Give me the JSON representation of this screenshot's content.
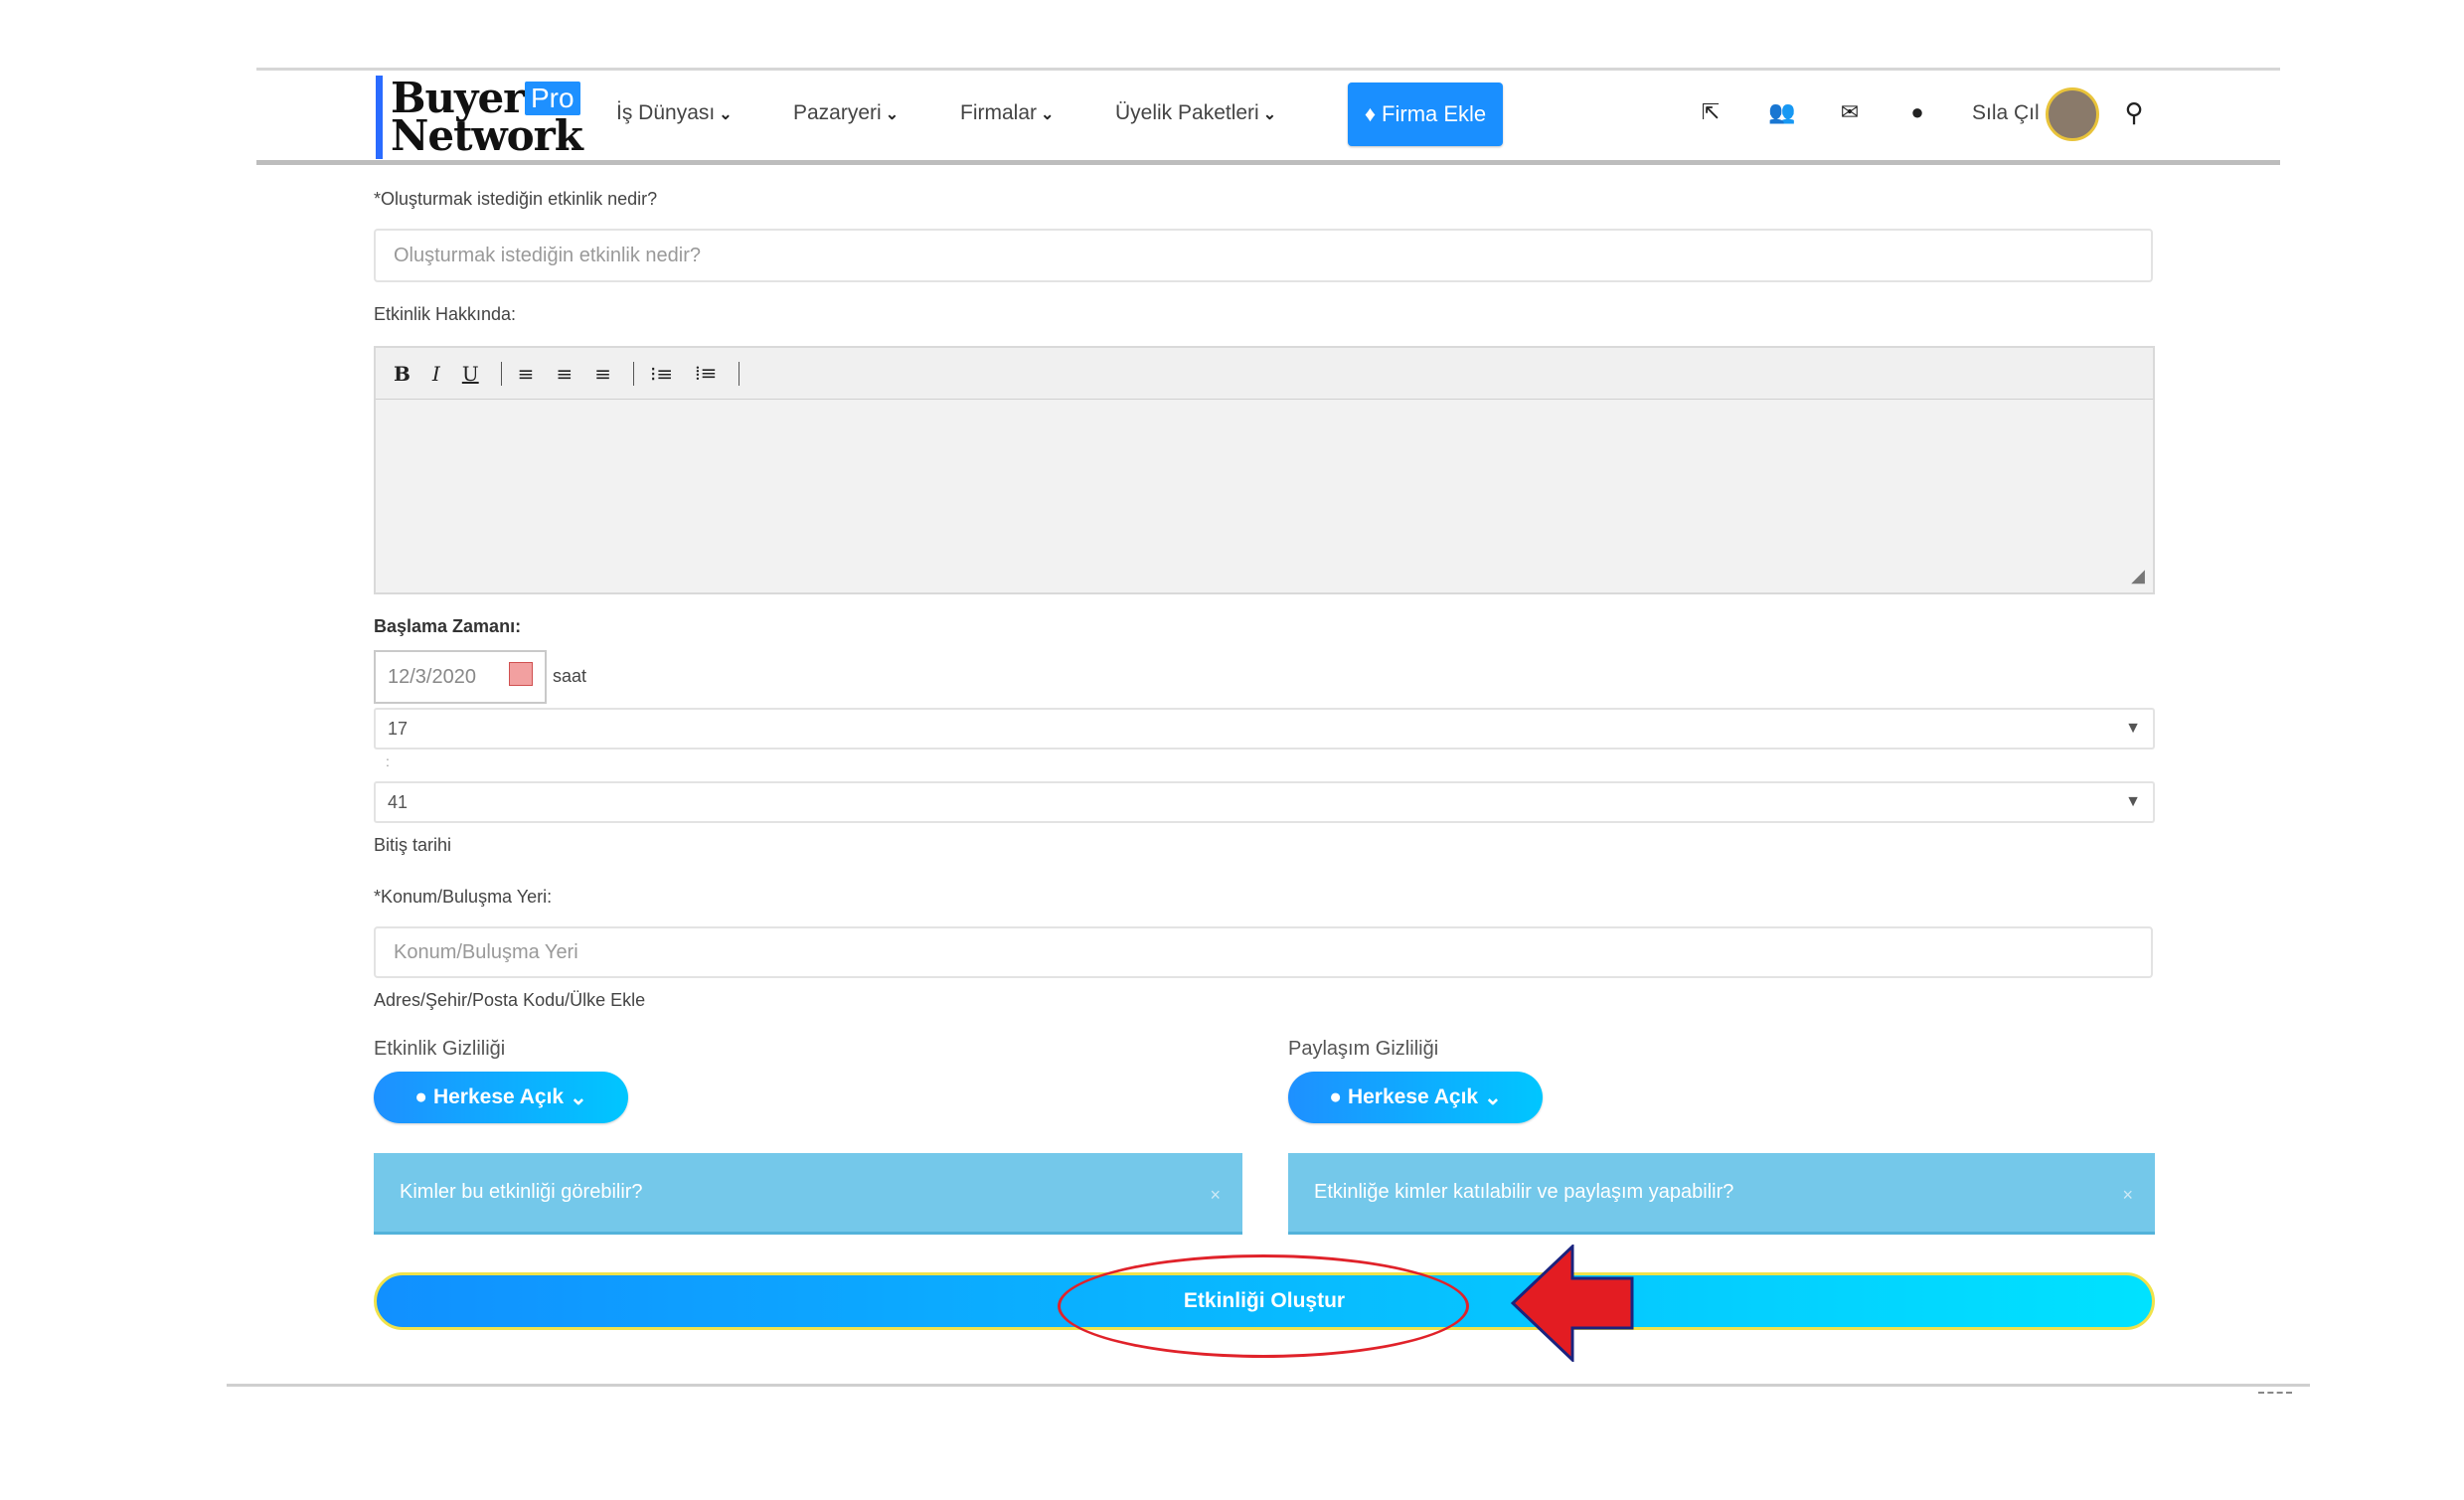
{
  "nav": {
    "logo_line1": "Buyer",
    "logo_line2": "Network",
    "logo_badge": "Pro",
    "menu": [
      {
        "label": "İş Dünyası"
      },
      {
        "label": "Pazaryeri"
      },
      {
        "label": "Firmalar"
      },
      {
        "label": "Üyelik Paketleri"
      }
    ],
    "cta_label": "Firma Ekle",
    "user_name": "Sıla Çıl",
    "icons": [
      "external-link-icon",
      "users-icon",
      "envelope-icon",
      "globe-icon",
      "search-icon"
    ],
    "accent_color": "#1a8fff"
  },
  "form": {
    "event_label": "*Oluşturmak istediğin etkinlik nedir?",
    "event_placeholder": "Oluşturmak istediğin etkinlik nedir?",
    "about_label": "Etkinlik Hakkında:",
    "toolbar": [
      "B",
      "I",
      "U"
    ],
    "start_label": "Başlama Zamanı:",
    "start_date": "12/3/2020",
    "saat_label": "saat",
    "hour_value": "17",
    "time_separator": ":",
    "minute_value": "41",
    "end_label": "Bitiş tarihi",
    "location_label": "*Konum/Buluşma Yeri:",
    "location_placeholder": "Konum/Buluşma Yeri",
    "address_link": "Adres/Şehir/Posta Kodu/Ülke Ekle",
    "event_privacy_label": "Etkinlik Gizliliği",
    "event_privacy_value": "Herkese Açık",
    "share_privacy_label": "Paylaşım Gizliliği",
    "share_privacy_value": "Herkese Açık",
    "event_privacy_info": "Kimler bu etkinliği görebilir?",
    "share_privacy_info": "Etkinliğe kimler katılabilir ve paylaşım yapabilir?",
    "close_symbol": "×",
    "submit_label": "Etkinliği Oluştur"
  },
  "annotation": {
    "highlight_color": "#e0222a"
  }
}
